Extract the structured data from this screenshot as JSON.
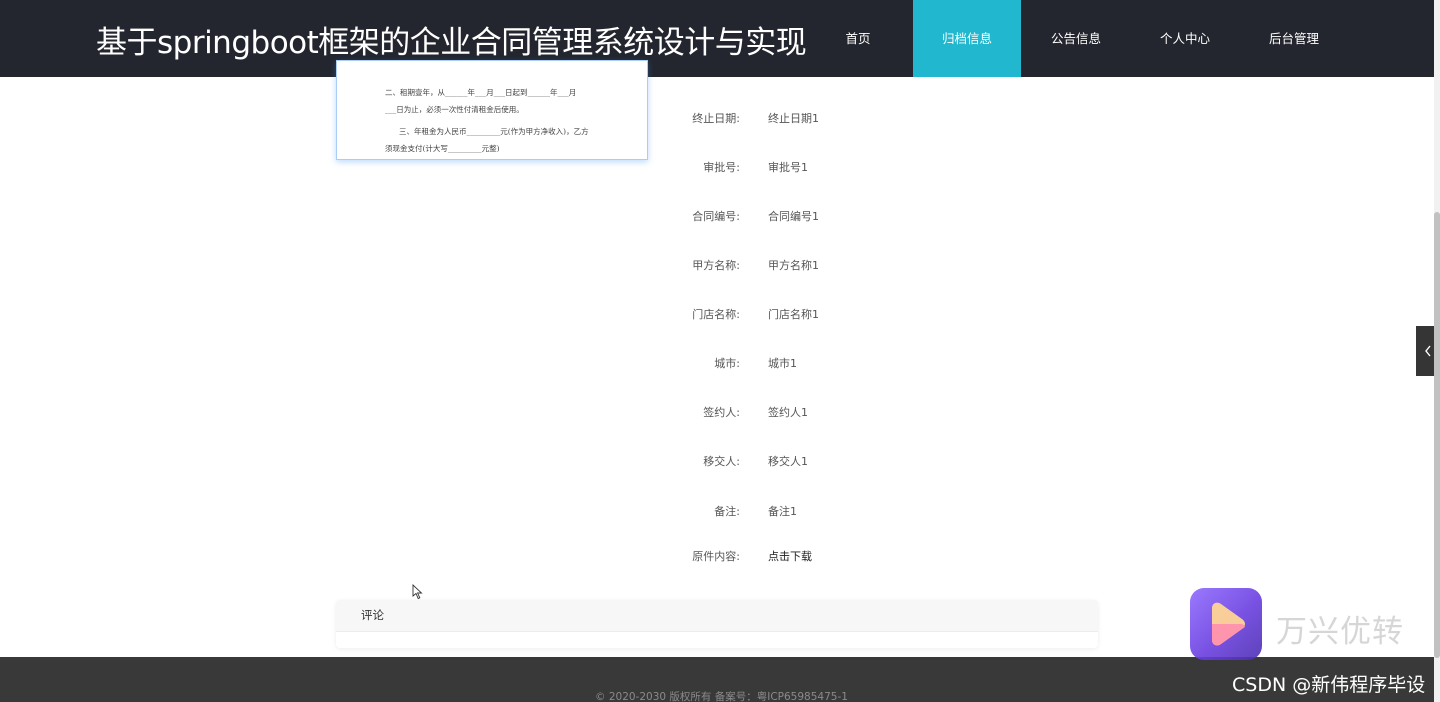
{
  "header": {
    "title": "基于springboot框架的企业合同管理系统设计与实现",
    "nav": [
      {
        "label": "首页"
      },
      {
        "label": "归档信息"
      },
      {
        "label": "公告信息"
      },
      {
        "label": "个人中心"
      },
      {
        "label": "后台管理"
      }
    ],
    "active_nav": "归档信息",
    "accent_color": "#21b8cf"
  },
  "document_preview": {
    "lines": [
      "二、租期壹年，从______年___月___日起到______年___月",
      "___日为止，必须一次性付清租金后使用。",
      "三、年租金为人民币_________元(作为甲方净收入)，乙方",
      "须现金支付(计大写_________元整)"
    ]
  },
  "details": [
    {
      "label": "终止日期:",
      "value": "终止日期1"
    },
    {
      "label": "审批号:",
      "value": "审批号1"
    },
    {
      "label": "合同编号:",
      "value": "合同编号1"
    },
    {
      "label": "甲方名称:",
      "value": "甲方名称1"
    },
    {
      "label": "门店名称:",
      "value": "门店名称1"
    },
    {
      "label": "城市:",
      "value": "城市1"
    },
    {
      "label": "签约人:",
      "value": "签约人1"
    },
    {
      "label": "移交人:",
      "value": "移交人1"
    },
    {
      "label": "备注:",
      "value": "备注1"
    },
    {
      "label": "原件内容:",
      "value": "点击下载"
    }
  ],
  "comments": {
    "title": "评论"
  },
  "footer": {
    "text": "© 2020-2030 版权所有 备案号：粤ICP65985475-1"
  },
  "side_tab": {
    "icon": "chevron-left-icon"
  },
  "watermark": {
    "brand": "万兴优转",
    "csdn": "CSDN @新伟程序毕设"
  }
}
